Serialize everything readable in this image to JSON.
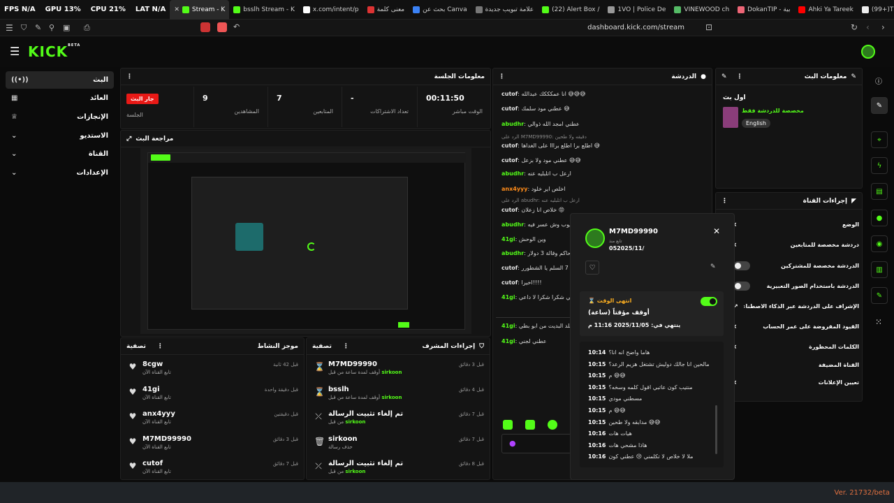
{
  "browser": {
    "stats": [
      "FPS N/A",
      "GPU 13%",
      "CPU 21%",
      "LAT N/A"
    ],
    "tabs": [
      {
        "label": "Stream - K",
        "color": "#53fc18",
        "active": true
      },
      {
        "label": "bsslh Stream - K",
        "color": "#53fc18"
      },
      {
        "label": "x.com/intent/p",
        "color": "#ffffff"
      },
      {
        "label": "معنى كلمة",
        "color": "#d33"
      },
      {
        "label": "بحث عن Canva",
        "color": "#3b82f6"
      },
      {
        "label": "علامة تبويب جديدة",
        "color": "#777"
      },
      {
        "label": "(22) Alert Box /",
        "color": "#53fc18"
      },
      {
        "label": "1VO | Police De",
        "color": "#999"
      },
      {
        "label": "VINEWOOD ch",
        "color": "#5b6"
      },
      {
        "label": "DokanTIP - بية",
        "color": "#e67"
      },
      {
        "label": "Ahki Ya Tareek",
        "color": "#f00"
      },
      {
        "label": "(99+)TikTok - M",
        "color": "#eee"
      }
    ],
    "url": "dashboard.kick.com/stream"
  },
  "nav": {
    "logo": "KICK",
    "logo_tag": "BETA",
    "items": [
      {
        "label": "البث",
        "icon": "live-icon"
      },
      {
        "label": "العائد",
        "icon": "bank-icon"
      },
      {
        "label": "الإنجازات",
        "icon": "trophy-icon"
      },
      {
        "label": "الاستديو",
        "icon": "chevron-down-icon"
      },
      {
        "label": "القناة",
        "icon": "chevron-down-icon"
      },
      {
        "label": "الإعدادات",
        "icon": "chevron-down-icon"
      }
    ]
  },
  "session": {
    "title": "معلومات الجلسة",
    "badge": "جار البث",
    "badge_label": "الجلسة",
    "cells": [
      {
        "value": "9",
        "label": "المشاهدين"
      },
      {
        "value": "7",
        "label": "المتابعين"
      },
      {
        "value": "-",
        "label": "تعداد الاشتراكات"
      },
      {
        "value": "00:11:50",
        "label": "الوقت مباشر"
      }
    ]
  },
  "preview": {
    "title": "مراجعة البث"
  },
  "activity": {
    "title": "موجز النشاط",
    "filter": "تصفية",
    "rows": [
      {
        "name": "8cgw",
        "sub": "تابع القناة الآن",
        "time": "قبل 42 ثانية"
      },
      {
        "name": "41gi",
        "sub": "تابع القناة الآن",
        "time": "قبل دقيقة واحدة"
      },
      {
        "name": "anx4yyy",
        "sub": "تابع القناة الآن",
        "time": "قبل دقيقتين"
      },
      {
        "name": "M7MD99990",
        "sub": "تابع القناة الآن",
        "time": "قبل 3 دقائق"
      },
      {
        "name": "cutof",
        "sub": "تابع القناة الآن",
        "time": "قبل 7 دقائق"
      }
    ]
  },
  "modactions": {
    "title": "إجراءات المشرف",
    "filter": "تصفية",
    "rows": [
      {
        "name": "M7MD99990",
        "sub": "أوقف لمدة ساعة من قبل",
        "by": "sirkoon",
        "time": "قبل 3 دقائق",
        "icon": "hourglass-icon"
      },
      {
        "name": "bsslh",
        "sub": "أوقف لمدة ساعة من قبل",
        "by": "sirkoon",
        "time": "قبل 4 دقائق",
        "icon": "hourglass-icon"
      },
      {
        "name": "تم إلغاء تثبيت الرسالة",
        "sub": "من قبل",
        "by": "sirkoon",
        "time": "قبل 7 دقائق",
        "icon": "unpin-icon"
      },
      {
        "name": "sirkoon",
        "sub": "حذف رسالة",
        "by": "",
        "time": "قبل 7 دقائق",
        "icon": "trash-icon"
      },
      {
        "name": "تم إلغاء تثبيت الرسالة",
        "sub": "من قبل",
        "by": "sirkoon",
        "time": "قبل 8 دقائق",
        "icon": "unpin-icon"
      }
    ]
  },
  "chat": {
    "title": "الدردشة",
    "lines": [
      {
        "user": "cutof",
        "color": "#e6e6e6",
        "text": "انا عمكككك عبدالله 😅😅😅"
      },
      {
        "user": "cutof",
        "color": "#e6e6e6",
        "text": "عطني مود سلمك 😅"
      },
      {
        "user": "abudhr",
        "color": "#53fc18",
        "text": "عطني امجد الله ذوالي"
      },
      {
        "user": "cutof",
        "color": "#e6e6e6",
        "text": "اطلع برا اطلع برااا على الغداها 😅"
      },
      {
        "user": "cutof",
        "color": "#e6e6e6",
        "text": "عطني مود ولا بزعل 😅😅"
      },
      {
        "user": "abudhr",
        "color": "#53fc18",
        "text": "ارعل ب اتلبليه عنه"
      },
      {
        "user": "anx4yyy",
        "color": "#ff8c1a",
        "text": "اخلص اير خلود"
      },
      {
        "user": "cutof",
        "color": "#e6e6e6",
        "text": "خلاص انا زعلان 😡"
      },
      {
        "user": "abudhr",
        "color": "#53fc18",
        "text": "بيوب وش عسر فيه"
      },
      {
        "user": "41gi",
        "color": "#53fc18",
        "text": "وين الوحش"
      },
      {
        "user": "abudhr",
        "color": "#53fc18",
        "text": "الحاكم وقالة 3 دولار"
      },
      {
        "user": "cutof",
        "color": "#e6e6e6",
        "text": "وانك 7 السلم يا الشطورر"
      },
      {
        "user": "cutof",
        "color": "#e6e6e6",
        "text": "اخيرا!!!!"
      },
      {
        "user": "41gi",
        "color": "#53fc18",
        "text": "اسمي شكرا شكرا لا داعي"
      },
      {
        "user": "41gi",
        "color": "#53fc18",
        "text": "قلد البديت من ابو بطي"
      },
      {
        "user": "41gi",
        "color": "#53fc18",
        "text": "عطني لجني"
      }
    ],
    "reply1": "الرد على M7MD99990: دقيقه ولا طحين",
    "reply2": "الرد على abudhr: ارعل ب اتلبليه عنه"
  },
  "userpopup": {
    "name": "M7MD99990",
    "since_label": "تابع منذ",
    "since": "052025/11/",
    "timeout_label": "انتهى الوقت",
    "timeout_title": "أوقف مؤقتاً (ساعة)",
    "timeout_end": "ينتهي في: 2025/11/05 11:16 م",
    "messages": [
      {
        "time": "10:14",
        "text": "هاما واضح انه انا؟"
      },
      {
        "time": "10:15",
        "text": "مالحين انا جالك دوليش تشتغل هزيم الرعد؟"
      },
      {
        "time": "10:15",
        "text": "م 😅😅"
      },
      {
        "time": "10:15",
        "text": "منتيب كون عاتبي اقول كلمه وسخه؟"
      },
      {
        "time": "10:15",
        "text": "مسطني مودي"
      },
      {
        "time": "10:15",
        "text": "م 😅😅"
      },
      {
        "time": "10:15",
        "text": "مدابقه ولا طحين 😅😅"
      },
      {
        "time": "10:16",
        "text": "هيات هات"
      },
      {
        "time": "10:16",
        "text": "هاذا مشحي هات"
      },
      {
        "time": "10:16",
        "text": "ملا لا خلاص لا تكلمني 😢 عطني كون"
      }
    ]
  },
  "streaminfo": {
    "title": "معلومات البث",
    "stream_title": "اول بث",
    "category": "مخصصة للدردشة فقط",
    "language": "English"
  },
  "channelactions": {
    "title": "إجراءات القناة",
    "rows": [
      {
        "label": "الوضع",
        "kind": "chevron"
      },
      {
        "label": "دردشة مخصصة للمتابعين",
        "kind": "chevron"
      },
      {
        "label": "الدردشة مخصصة للمشتركين",
        "kind": "toggle"
      },
      {
        "label": "الدردشة باستخدام الصور التعبيرية",
        "kind": "toggle"
      },
      {
        "label": "الإشراف على الدردشة عبر الذكاء الاصطناعي",
        "kind": "link"
      },
      {
        "label": "القيود المفروضة على عمر الحساب",
        "kind": "chevron"
      },
      {
        "label": "الكلمات المحظورة",
        "kind": "chevron"
      },
      {
        "label": "القناة المضيفة",
        "kind": "none"
      },
      {
        "label": "تعيين الإعلانات",
        "kind": "chevron"
      }
    ]
  },
  "version": "Ver. 21732/beta"
}
